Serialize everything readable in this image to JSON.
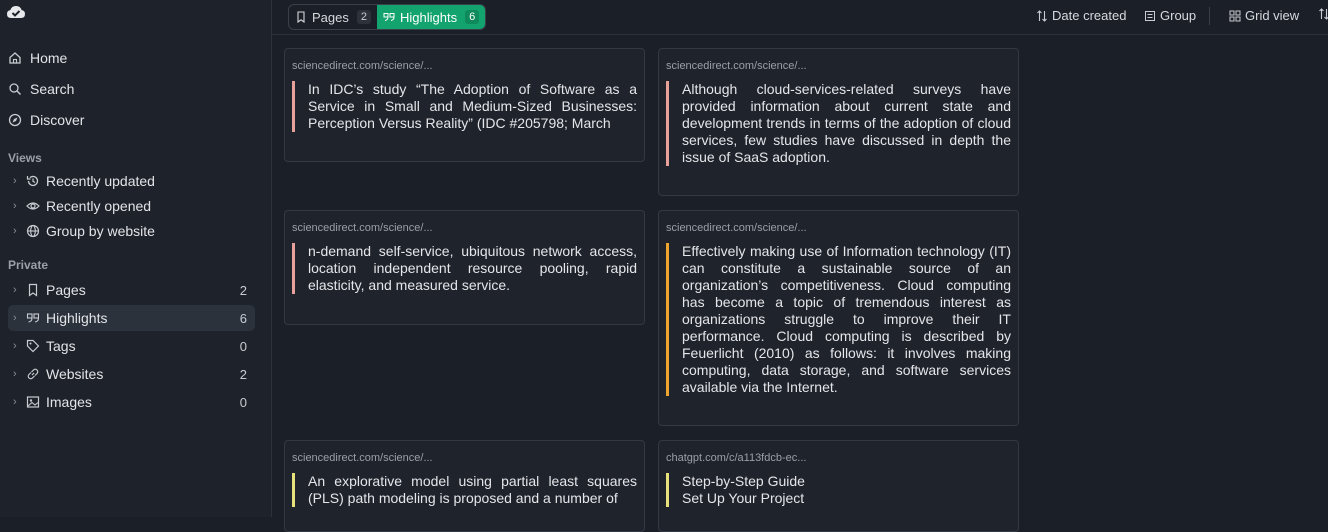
{
  "sidebar": {
    "nav": [
      {
        "label": "Home",
        "icon": "home-icon"
      },
      {
        "label": "Search",
        "icon": "search-icon"
      },
      {
        "label": "Discover",
        "icon": "compass-icon"
      }
    ],
    "views_label": "Views",
    "views": [
      {
        "label": "Recently updated",
        "icon": "history-icon"
      },
      {
        "label": "Recently opened",
        "icon": "eye-icon"
      },
      {
        "label": "Group by website",
        "icon": "globe-icon"
      }
    ],
    "private_label": "Private",
    "private": [
      {
        "label": "Pages",
        "count": "2",
        "icon": "bookmark-icon"
      },
      {
        "label": "Highlights",
        "count": "6",
        "icon": "quote-icon",
        "active": true
      },
      {
        "label": "Tags",
        "count": "0",
        "icon": "tag-icon"
      },
      {
        "label": "Websites",
        "count": "2",
        "icon": "link-icon"
      },
      {
        "label": "Images",
        "count": "0",
        "icon": "image-icon"
      }
    ]
  },
  "toolbar": {
    "pages_label": "Pages",
    "pages_count": "2",
    "highlights_label": "Highlights",
    "highlights_count": "6",
    "sort_label": "Date created",
    "group_label": "Group",
    "view_label": "Grid view"
  },
  "cards": [
    {
      "source": "sciencedirect.com/science/...",
      "text": "In IDC’s study “The Adoption of Software as a Service in Small and Medium-Sized Businesses: Perception Versus Reality” (IDC #205798; March"
    },
    {
      "source": "sciencedirect.com/science/...",
      "text": "Although cloud-services-related surveys have provided information about current state and development trends in terms of the adoption of cloud services, few studies have discussed in depth the issue of SaaS adoption."
    },
    {
      "source": "sciencedirect.com/science/...",
      "text": "n-demand self-service, ubiquitous network access, location independent resource pooling, rapid elasticity, and measured service."
    },
    {
      "source": "sciencedirect.com/science/...",
      "text": "Effectively making use of Information technology (IT) can constitute a sustainable source of an organization’s competitiveness. Cloud computing has become a topic of tremendous interest as organizations struggle to improve their IT performance. Cloud computing is described by Feuerlicht (2010) as follows: it involves making computing, data storage, and software services available via the Internet."
    },
    {
      "source": "sciencedirect.com/science/...",
      "text": "An explorative model using partial least squares (PLS) path modeling is proposed and a number of"
    },
    {
      "source": "chatgpt.com/c/a113fdcb-ec...",
      "text": "Step-by-Step Guide\nSet Up Your Project"
    }
  ]
}
